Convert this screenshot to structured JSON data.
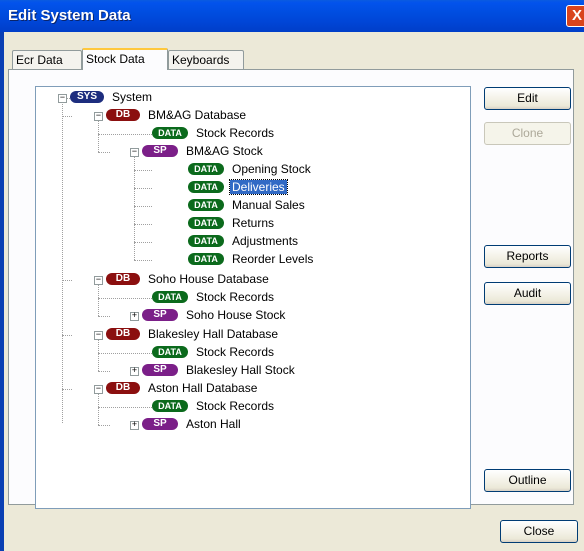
{
  "window": {
    "title": "Edit System Data",
    "close_glyph": "X"
  },
  "tabs": [
    {
      "label": "Ecr Data",
      "active": false
    },
    {
      "label": "Stock Data",
      "active": true
    },
    {
      "label": "Keyboards",
      "active": false
    }
  ],
  "tree": {
    "root": {
      "tag": "SYS",
      "label": "System"
    },
    "db1": {
      "tag": "DB",
      "label": "BM&AG Database"
    },
    "db1_records": {
      "tag": "DATA",
      "label": "Stock Records"
    },
    "db1_sp": {
      "tag": "SP",
      "label": "BM&AG Stock"
    },
    "db1_sp_items": [
      {
        "tag": "DATA",
        "label": "Opening Stock"
      },
      {
        "tag": "DATA",
        "label": "Deliveries",
        "selected": true
      },
      {
        "tag": "DATA",
        "label": "Manual Sales"
      },
      {
        "tag": "DATA",
        "label": "Returns"
      },
      {
        "tag": "DATA",
        "label": "Adjustments"
      },
      {
        "tag": "DATA",
        "label": "Reorder Levels"
      }
    ],
    "db2": {
      "tag": "DB",
      "label": "Soho House Database"
    },
    "db2_records": {
      "tag": "DATA",
      "label": "Stock Records"
    },
    "db2_sp": {
      "tag": "SP",
      "label": "Soho House Stock"
    },
    "db3": {
      "tag": "DB",
      "label": "Blakesley Hall Database"
    },
    "db3_records": {
      "tag": "DATA",
      "label": "Stock Records"
    },
    "db3_sp": {
      "tag": "SP",
      "label": "Blakesley Hall Stock"
    },
    "db4": {
      "tag": "DB",
      "label": "Aston Hall Database"
    },
    "db4_records": {
      "tag": "DATA",
      "label": "Stock Records"
    },
    "db4_sp": {
      "tag": "SP",
      "label": "Aston Hall"
    },
    "expand_minus": "−",
    "expand_plus": "+"
  },
  "buttons": {
    "edit": "Edit",
    "clone": "Clone",
    "reports": "Reports",
    "audit": "Audit",
    "outline": "Outline",
    "close": "Close"
  },
  "colors": {
    "titlebar": "#0054e3",
    "sys_tag": "#1d2d7e",
    "db_tag": "#8b0f0f",
    "sp_tag": "#7b1f88",
    "data_tag": "#0b6a1c",
    "selection": "#316ac5"
  }
}
